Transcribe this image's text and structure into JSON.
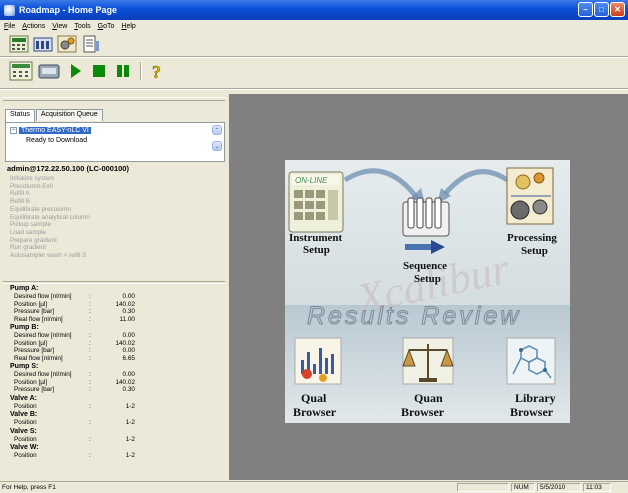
{
  "window": {
    "title": "Roadmap - Home Page"
  },
  "menu": [
    "File",
    "Actions",
    "View",
    "Tools",
    "GoTo",
    "Help"
  ],
  "toolbar_top": [
    {
      "name": "on-line-icon"
    },
    {
      "name": "instrument-status-icon"
    },
    {
      "name": "gears-icon"
    },
    {
      "name": "report-icon"
    }
  ],
  "toolbar_bottom": [
    {
      "name": "on-line-icon"
    },
    {
      "name": "autosampler-icon"
    },
    {
      "name": "play-icon"
    },
    {
      "name": "stop-icon"
    },
    {
      "name": "pause-icon"
    },
    {
      "name": "help-icon"
    }
  ],
  "tabs": [
    "Status",
    "Acquisition Queue"
  ],
  "instrument": {
    "name": "Thermo EASY-nLC VI",
    "state": "Ready to Download"
  },
  "connection": "admin@172.22.50.100 (LC-000100)",
  "steps": [
    "Initialize system",
    "Precolumn-Ex0",
    "Refill A",
    "Refill B",
    "Equilibrate precolumn",
    "Equilibrate analytical column",
    "Pickup sample",
    "Load sample",
    "Prepare gradient",
    "Run gradient",
    "Autosampler wash > refill S"
  ],
  "status_groups": [
    {
      "title": "Pump A:",
      "rows": [
        {
          "label": "Desired flow [nl/min]",
          "value": "0.00"
        },
        {
          "label": "Position [µl]",
          "value": "140.02"
        },
        {
          "label": "Pressure [bar]",
          "value": "0.30"
        },
        {
          "label": "Real flow [nl/min]",
          "value": "11.00"
        }
      ]
    },
    {
      "title": "Pump B:",
      "rows": [
        {
          "label": "Desired flow [nl/min]",
          "value": "0.00"
        },
        {
          "label": "Position [µl]",
          "value": "140.02"
        },
        {
          "label": "Pressure [bar]",
          "value": "0.00"
        },
        {
          "label": "Real flow [nl/min]",
          "value": "6.65"
        }
      ]
    },
    {
      "title": "Pump S:",
      "rows": [
        {
          "label": "Desired flow [nl/min]",
          "value": "0.00"
        },
        {
          "label": "Position [µl]",
          "value": "140.02"
        },
        {
          "label": "Pressure [bar]",
          "value": "0.30"
        }
      ]
    },
    {
      "title": "Valve A:",
      "rows": [
        {
          "label": "Position",
          "value": "1-2"
        }
      ]
    },
    {
      "title": "Valve B:",
      "rows": [
        {
          "label": "Position",
          "value": "1-2"
        }
      ]
    },
    {
      "title": "Valve S:",
      "rows": [
        {
          "label": "Position",
          "value": "1-2"
        }
      ]
    },
    {
      "title": "Valve W:",
      "rows": [
        {
          "label": "Position",
          "value": "1-2"
        }
      ]
    }
  ],
  "roadmap": {
    "online_label": "ON-LINE",
    "instrument_setup": [
      "Instrument",
      "Setup"
    ],
    "sequence_setup": [
      "Sequence",
      "Setup"
    ],
    "processing_setup": [
      "Processing",
      "Setup"
    ],
    "results_review": "Results Review",
    "watermark": "Xcalibur",
    "qual_browser": [
      "Qual",
      "Browser"
    ],
    "quan_browser": [
      "Quan",
      "Browser"
    ],
    "library_browser": [
      "Library",
      "Browser"
    ]
  },
  "statusbar": {
    "help": "For Help, press F1",
    "num": "NUM",
    "date": "5/5/2010",
    "time": "11:03"
  },
  "colors": {
    "title_bar": "#0A4FD8",
    "selection": "#316AC5",
    "workspace": "#808080",
    "splash_bg": "#dfe5e7"
  }
}
